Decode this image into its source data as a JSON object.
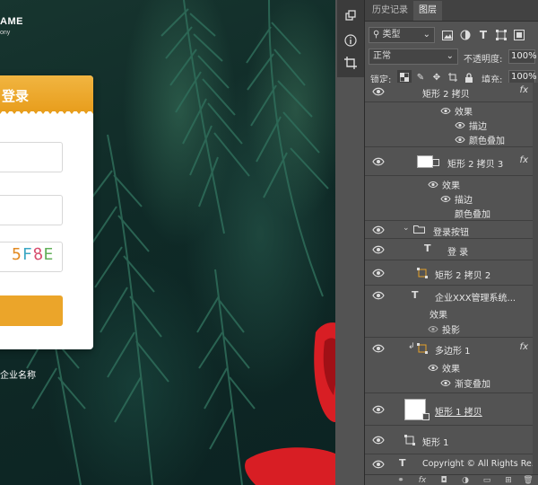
{
  "canvas": {
    "brand_name": "AME",
    "brand_sub": "ony",
    "login_title": "登录",
    "captcha": [
      "5",
      "F",
      "8",
      "E"
    ],
    "captcha_colors": [
      "#e28a22",
      "#3ba7c4",
      "#d74e6e",
      "#62b05a"
    ],
    "company": "企业名称",
    "accent": "#eba52a"
  },
  "tools": {
    "items": [
      "cube-3d-icon",
      "info-icon",
      "crop-icon"
    ]
  },
  "panel": {
    "tabs": [
      "历史记录",
      "图层"
    ],
    "active_tab": "图层",
    "filter_kind": "类型",
    "blend_mode": "正常",
    "opacity_label": "不透明度:",
    "opacity_value": "100%",
    "lock_label": "锁定:",
    "fill_label": "填充:",
    "fill_value": "100%",
    "layers": [
      {
        "name": "矩形 2 拷贝",
        "fx": "fx"
      },
      {
        "effects": "效果"
      },
      {
        "effect": "描边"
      },
      {
        "effect": "颜色叠加"
      },
      {
        "name": "矩形 2 拷贝 3",
        "fx": "fx"
      },
      {
        "effects": "效果"
      },
      {
        "effect": "描边"
      },
      {
        "effect": "颜色叠加"
      },
      {
        "name": "登录按钮"
      },
      {
        "name": "登 录"
      },
      {
        "name": "矩形 2 拷贝 2"
      },
      {
        "name": "企业XXX管理系统..."
      },
      {
        "effects": "效果"
      },
      {
        "effect": "投影"
      },
      {
        "name": "多边形 1",
        "fx": "fx"
      },
      {
        "effects": "效果"
      },
      {
        "effect": "渐变叠加"
      },
      {
        "name": "矩形 1 拷贝"
      },
      {
        "name": "矩形 1"
      },
      {
        "name": "Copyright © All Rights Re..."
      }
    ]
  }
}
